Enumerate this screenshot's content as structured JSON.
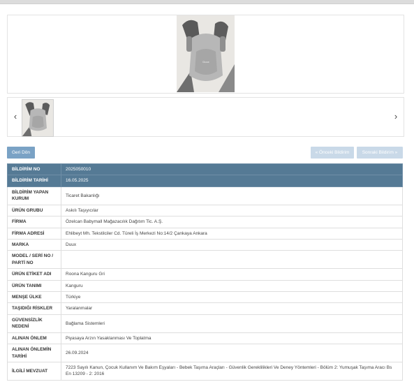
{
  "buttons": {
    "back": "Geri Dön",
    "prev_record": "« Önceki Bildirim",
    "next_record": "Sonraki Bildirim »"
  },
  "gallery": {
    "prev_icon": "‹",
    "next_icon": "›",
    "photo_label": "Duux"
  },
  "details": [
    {
      "label": "BİLDİRİM NO",
      "value": "2025050010",
      "highlight": true
    },
    {
      "label": "BİLDİRİM TARİHİ",
      "value": "16.05.2025",
      "highlight": true
    },
    {
      "label": "BİLDİRİM YAPAN KURUM",
      "value": "Ticaret Bakanlığı"
    },
    {
      "label": "ÜRÜN GRUBU",
      "value": "Askılı Taşıyıcılar"
    },
    {
      "label": "FİRMA",
      "value": "Özelcan Babymall Mağazacılık Dağıtım Tic. A.Ş."
    },
    {
      "label": "FİRMA ADRESİ",
      "value": "Ehlibeyt Mh. Tekstilciler Cd. Türeli İş Merkezi No:14/2 Çankaya Ankara"
    },
    {
      "label": "MARKA",
      "value": "Duux"
    },
    {
      "label": "MODEL / SERİ NO / PARTİ NO",
      "value": ""
    },
    {
      "label": "ÜRÜN ETİKET ADI",
      "value": "Roona Kanguru Gri"
    },
    {
      "label": "ÜRÜN TANIMI",
      "value": "Kanguru"
    },
    {
      "label": "MENŞE ÜLKE",
      "value": "Türkiye"
    },
    {
      "label": "TAŞIDIĞI RİSKLER",
      "value": "Yaralanmalar"
    },
    {
      "label": "GÜVENSİZLİK NEDENİ",
      "value": "Bağlama Sistemleri"
    },
    {
      "label": "ALINAN ÖNLEM",
      "value": "Piyasaya Arzın Yasaklanması Ve Toplatma"
    },
    {
      "label": "ALINAN ÖNLEMİN TARİHİ",
      "value": "26.09.2024"
    },
    {
      "label": "İLGİLİ MEVZUAT",
      "value": "7223 Sayılı Kanun, Çocuk Kullanım Ve Bakım Eşyaları - Bebek Taşıma Araçları - Güvenlik Gereklilikleri Ve Deney Yöntemleri - Bölüm 2: Yumuşak Taşıma Aracı Bs En 13209 - 2: 2016"
    }
  ]
}
